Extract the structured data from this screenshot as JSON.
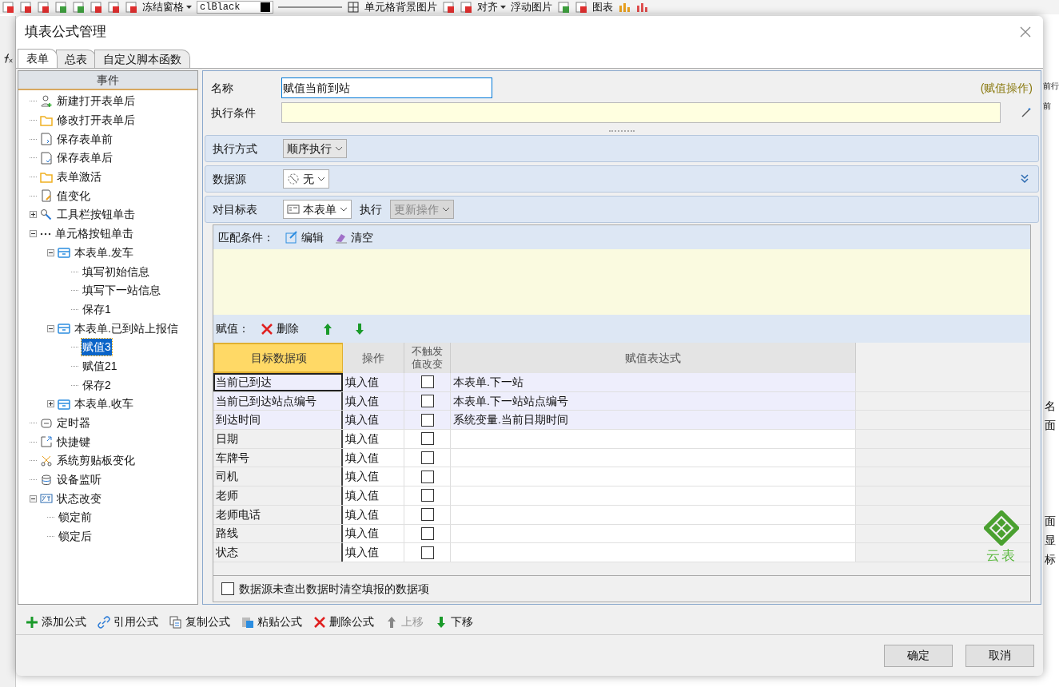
{
  "app_toolbar": {
    "freeze": "冻结窗格",
    "color_field": "clBlack",
    "cell_bg": "单元格背景图片",
    "align": "对齐",
    "float_image": "浮动图片",
    "chart": "图表"
  },
  "app_side_texts": [
    "前行",
    "前"
  ],
  "app_grid_texts": [
    "名",
    "面",
    "面",
    "显",
    "标"
  ],
  "dialog": {
    "title": "填表公式管理"
  },
  "tabs": [
    {
      "label": "表单",
      "selected": true
    },
    {
      "label": "总表",
      "selected": false
    },
    {
      "label": "自定义脚本函数",
      "selected": false
    }
  ],
  "event_tree": {
    "header": "事件",
    "items": [
      {
        "label": "新建打开表单后",
        "selected": false
      },
      {
        "label": "修改打开表单后",
        "selected": false
      },
      {
        "label": "保存表单前",
        "selected": false
      },
      {
        "label": "保存表单后",
        "selected": false
      },
      {
        "label": "表单激活",
        "selected": false
      },
      {
        "label": "值变化",
        "selected": false
      },
      {
        "label": "工具栏按钮单击",
        "selected": false,
        "expanded": false
      },
      {
        "label": "单元格按钮单击",
        "selected": false,
        "expanded": true,
        "children": [
          {
            "label": "本表单.发车",
            "selected": false,
            "expanded": true,
            "children": [
              {
                "label": "填写初始信息",
                "selected": false
              },
              {
                "label": "填写下一站信息",
                "selected": false
              },
              {
                "label": "保存1",
                "selected": false
              }
            ]
          },
          {
            "label": "本表单.已到站上报信",
            "selected": false,
            "expanded": true,
            "children": [
              {
                "label": "赋值3",
                "selected": true
              },
              {
                "label": "赋值21",
                "selected": false
              },
              {
                "label": "保存2",
                "selected": false
              }
            ]
          },
          {
            "label": "本表单.收车",
            "selected": false,
            "expanded": false
          }
        ]
      },
      {
        "label": "定时器",
        "selected": false
      },
      {
        "label": "快捷键",
        "selected": false
      },
      {
        "label": "系统剪贴板变化",
        "selected": false
      },
      {
        "label": "设备监听",
        "selected": false
      },
      {
        "label": "状态改变",
        "selected": false,
        "expanded": true,
        "children": [
          {
            "label": "锁定前",
            "selected": false
          },
          {
            "label": "锁定后",
            "selected": false
          }
        ]
      }
    ]
  },
  "formula": {
    "name_label": "名称",
    "name_value": "赋值当前到站",
    "type_hint": "(赋值操作)",
    "condition_label": "执行条件",
    "exec_mode": {
      "label": "执行方式",
      "value": "顺序执行"
    },
    "datasource": {
      "label": "数据源",
      "value": "无"
    },
    "target": {
      "label": "对目标表",
      "value": "本表单",
      "exec_label": "执行",
      "exec_value": "更新操作",
      "exec_disabled": true
    },
    "match": {
      "label": "匹配条件：",
      "edit": "编辑",
      "clear": "清空"
    },
    "assign": {
      "label": "赋值：",
      "delete": "删除"
    },
    "table": {
      "columns": [
        "目标数据项",
        "操作",
        "不触发值改变",
        "赋值表达式"
      ],
      "rows": [
        {
          "target": "当前已到达",
          "op": "填入值",
          "no_trigger": false,
          "expr": "本表单.下一站",
          "mapped": true,
          "selected": true
        },
        {
          "target": "当前已到达站点编号",
          "op": "填入值",
          "no_trigger": false,
          "expr": "本表单.下一站站点编号",
          "mapped": true,
          "selected": false
        },
        {
          "target": "到达时间",
          "op": "填入值",
          "no_trigger": false,
          "expr": "系统变量.当前日期时间",
          "mapped": true,
          "selected": false
        },
        {
          "target": "日期",
          "op": "填入值",
          "no_trigger": false,
          "mapped": false,
          "selected": false
        },
        {
          "target": "车牌号",
          "op": "填入值",
          "no_trigger": false,
          "mapped": false,
          "selected": false
        },
        {
          "target": "司机",
          "op": "填入值",
          "no_trigger": false,
          "mapped": false,
          "selected": false
        },
        {
          "target": "老师",
          "op": "填入值",
          "no_trigger": false,
          "mapped": false,
          "selected": false
        },
        {
          "target": "老师电话",
          "op": "填入值",
          "no_trigger": false,
          "mapped": false,
          "selected": false
        },
        {
          "target": "路线",
          "op": "填入值",
          "no_trigger": false,
          "mapped": false,
          "selected": false
        },
        {
          "target": "状态",
          "op": "填入值",
          "no_trigger": false,
          "mapped": false,
          "selected": false
        }
      ]
    },
    "clear_option": {
      "label": "数据源未查出数据时清空填报的数据项",
      "checked": false
    }
  },
  "bottom_toolbar": [
    {
      "label": "添加公式",
      "kind": "add",
      "disabled": false
    },
    {
      "label": "引用公式",
      "kind": "link",
      "disabled": false
    },
    {
      "label": "复制公式",
      "kind": "copy",
      "disabled": false
    },
    {
      "label": "粘贴公式",
      "kind": "paste",
      "disabled": false
    },
    {
      "label": "删除公式",
      "kind": "delete",
      "disabled": false
    },
    {
      "label": "上移",
      "kind": "up",
      "disabled": true
    },
    {
      "label": "下移",
      "kind": "down",
      "disabled": false
    }
  ],
  "buttons": [
    "确定",
    "取消"
  ],
  "logo": "云表"
}
